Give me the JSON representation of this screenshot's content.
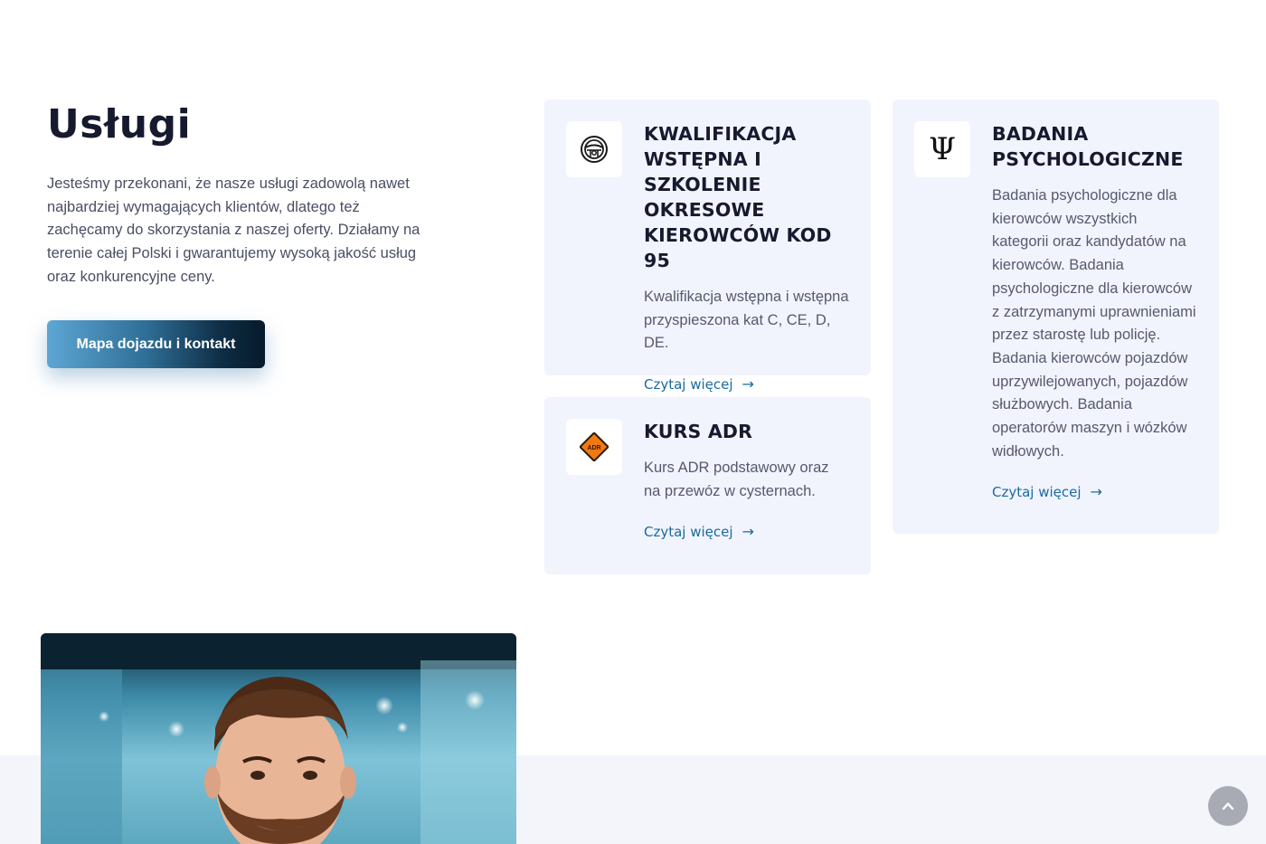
{
  "intro": {
    "title": "Usługi",
    "description": "Jesteśmy przekonani, że nasze usługi zadowolą nawet najbardziej wymagających klientów, dlatego też zachęcamy do skorzystania z naszej oferty. Działamy na terenie całej Polski i gwarantujemy wysoką jakość usług oraz konkurencyjne ceny.",
    "cta_label": "Mapa dojazdu i kontakt"
  },
  "services": [
    {
      "icon": "steering-wheel-icon",
      "title": "KWALIFIKACJA WSTĘPNA I SZKOLENIE OKRESOWE KIEROWCÓW KOD 95",
      "description": "Kwalifikacja wstępna i wstępna przyspieszona kat C, CE, D, DE.",
      "link_label": "Czytaj więcej"
    },
    {
      "icon": "adr-hazard-sign-icon",
      "icon_text": "ADR",
      "title": "KURS ADR",
      "description": "Kurs ADR podstawowy oraz na przewóz w cysternach.",
      "link_label": "Czytaj więcej"
    },
    {
      "icon": "psi-icon",
      "title": "BADANIA PSYCHOLOGICZNE",
      "description": "Badania psychologiczne dla kierowców wszystkich kategorii oraz kandydatów na kierowców. Badania psychologiczne dla kierowców z zatrzymanymi uprawnieniami przez starostę lub policję. Badania kierowców pojazdów uprzywilejowanych, pojazdów służbowych. Badania operatorów maszyn i wózków widłowych.",
      "link_label": "Czytaj więcej"
    }
  ],
  "colors": {
    "accent": "#1b6aa0",
    "card_bg": "#f1f4fc",
    "adr_orange": "#f07a12"
  },
  "photo": {
    "alt": "smiling man with beard"
  },
  "scroll_top": {
    "icon": "chevron-up-icon"
  }
}
